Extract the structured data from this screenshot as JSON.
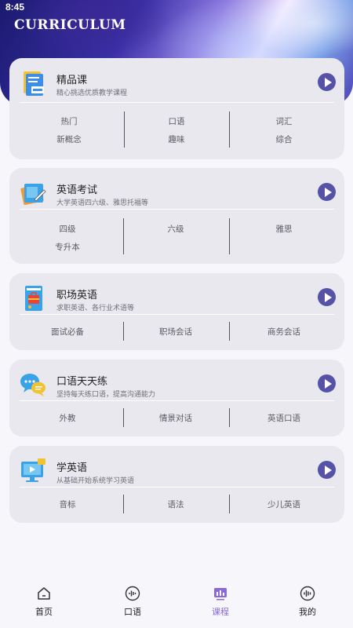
{
  "status_bar": {
    "time": "8:45"
  },
  "header": {
    "title": "CURRICULUM"
  },
  "cards": [
    {
      "title": "精品课",
      "subtitle": "精心挑选优质教学课程",
      "icon": "notebook-icon",
      "tags": [
        [
          "热门",
          "口语",
          "词汇"
        ],
        [
          "新概念",
          "趣味",
          "综合"
        ]
      ]
    },
    {
      "title": "英语考试",
      "subtitle": "大学英语四六级、雅思托福等",
      "icon": "exam-book-icon",
      "tags": [
        [
          "四级",
          "六级",
          "雅思"
        ],
        [
          "专升本",
          "",
          ""
        ]
      ]
    },
    {
      "title": "职场英语",
      "subtitle": "求职英语、各行业术语等",
      "icon": "briefcase-book-icon",
      "tags": [
        [
          "面试必备",
          "职场会话",
          "商务会话"
        ]
      ]
    },
    {
      "title": "口语天天练",
      "subtitle": "坚持每天练口语，提高沟通能力",
      "icon": "chat-bubbles-icon",
      "tags": [
        [
          "外教",
          "情景对话",
          "英语口语"
        ]
      ]
    },
    {
      "title": "学英语",
      "subtitle": "从基础开始系统学习英语",
      "icon": "video-screen-icon",
      "tags": [
        [
          "音标",
          "语法",
          "少儿英语"
        ]
      ]
    }
  ],
  "tabbar": {
    "active": "课程",
    "accent_color": "#8a6ad8",
    "items": [
      {
        "label": "首页",
        "icon": "home-icon"
      },
      {
        "label": "口语",
        "icon": "voice-wave-icon"
      },
      {
        "label": "课程",
        "icon": "course-chart-icon"
      },
      {
        "label": "我的",
        "icon": "profile-wave-icon"
      }
    ]
  }
}
